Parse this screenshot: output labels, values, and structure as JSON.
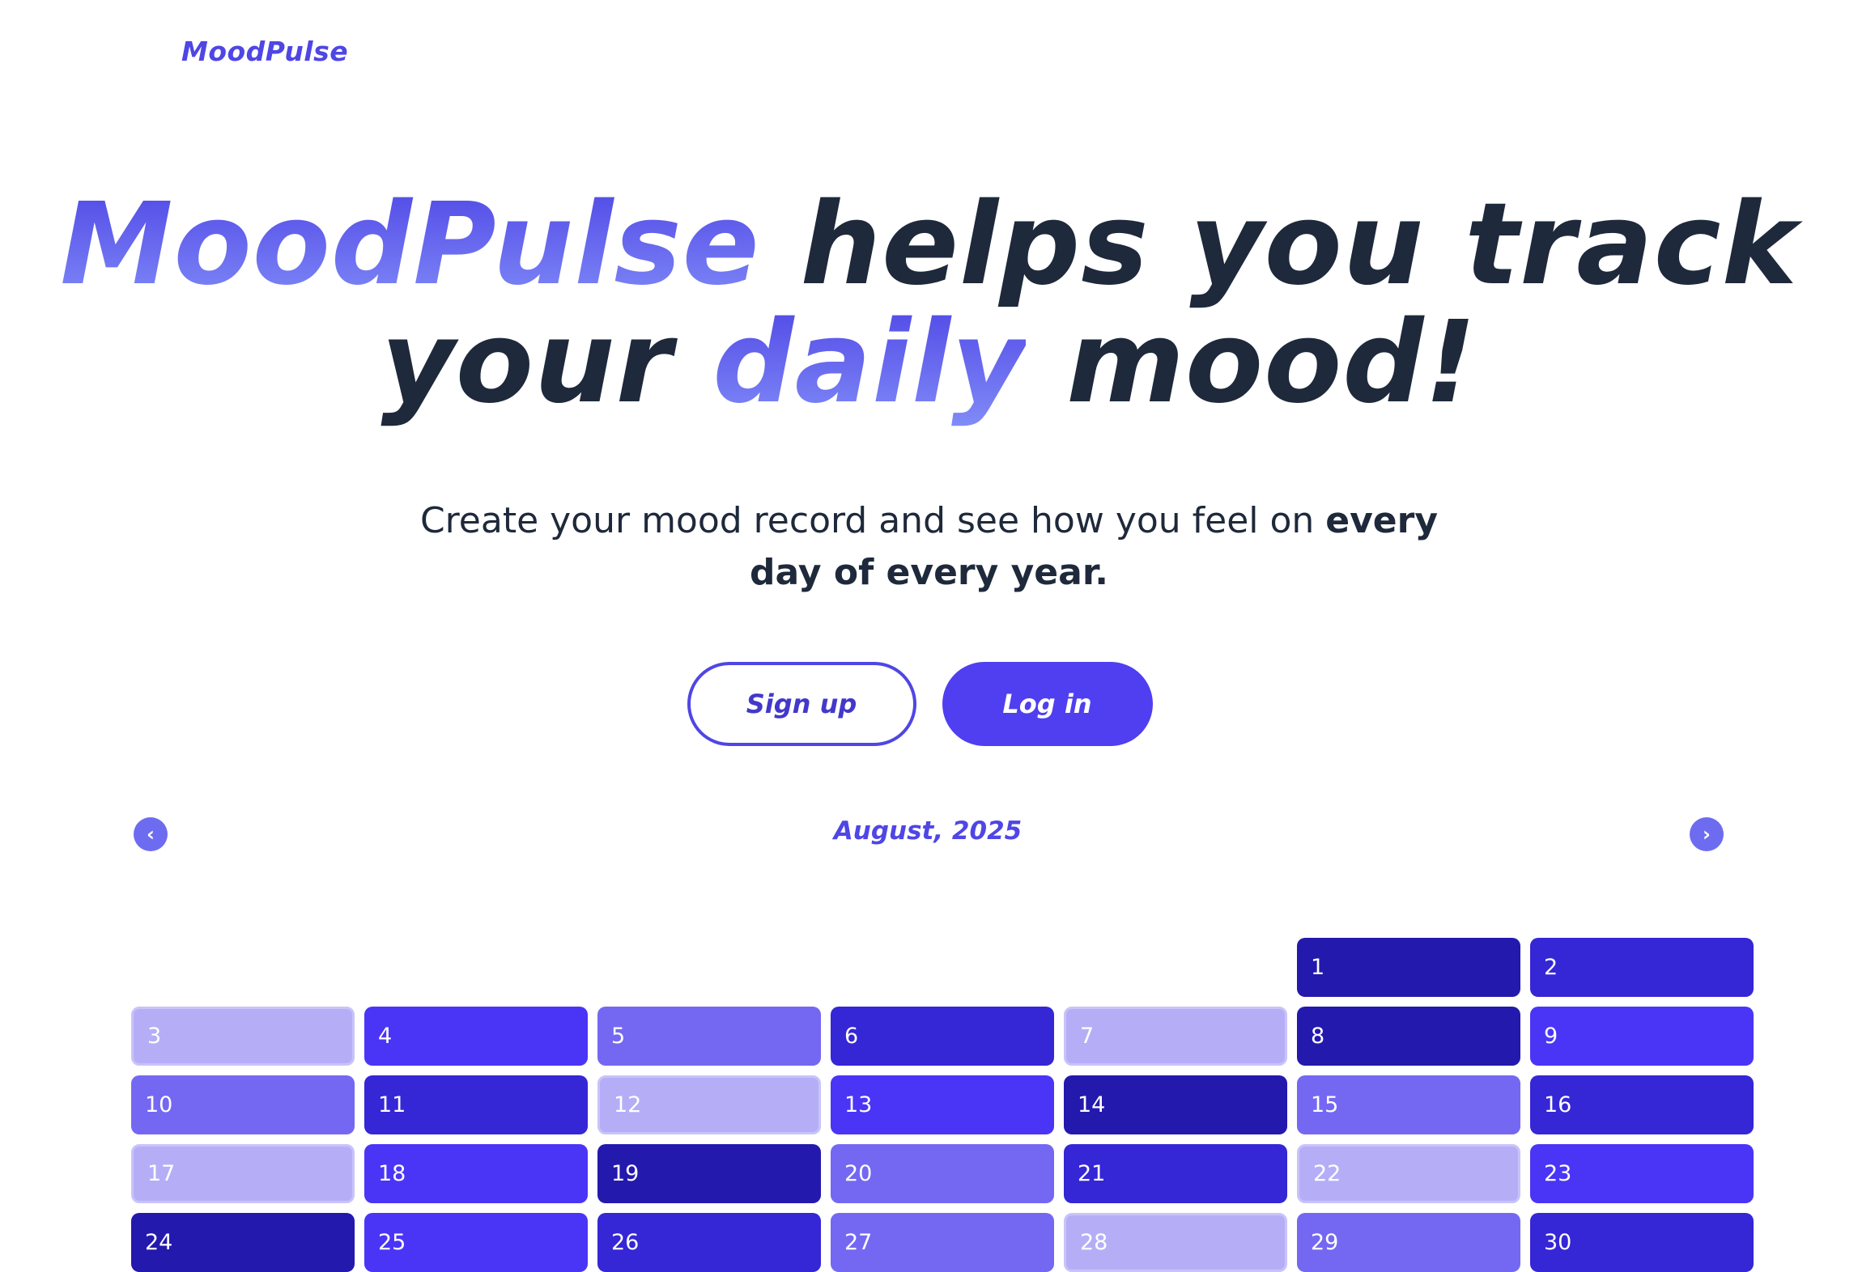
{
  "brand": {
    "logo": "MoodPulse"
  },
  "hero": {
    "headline_brand": "MoodPulse",
    "headline_part1": " helps you track",
    "headline_your": "your ",
    "headline_daily": "daily",
    "headline_end": " mood!",
    "subtitle_plain": "Create your mood record and see how you feel on ",
    "subtitle_bold1": "every",
    "subtitle_bold2": "day of every year."
  },
  "actions": {
    "signup_label": "Sign up",
    "login_label": "Log in"
  },
  "calendar": {
    "month_label": "August, 2025",
    "prev_icon": "chevron-left-icon",
    "next_icon": "chevron-right-icon",
    "mood_colors": {
      "1": "#b5aef7",
      "2": "#7468f2",
      "3": "#4a35f6",
      "4": "#3526d6",
      "5": "#2419ad"
    },
    "leading_empty_cells": 5,
    "days": [
      {
        "day": "1",
        "mood": 5
      },
      {
        "day": "2",
        "mood": 4
      },
      {
        "day": "3",
        "mood": 1
      },
      {
        "day": "4",
        "mood": 3
      },
      {
        "day": "5",
        "mood": 2
      },
      {
        "day": "6",
        "mood": 4
      },
      {
        "day": "7",
        "mood": 1
      },
      {
        "day": "8",
        "mood": 5
      },
      {
        "day": "9",
        "mood": 3
      },
      {
        "day": "10",
        "mood": 2
      },
      {
        "day": "11",
        "mood": 4
      },
      {
        "day": "12",
        "mood": 1
      },
      {
        "day": "13",
        "mood": 3
      },
      {
        "day": "14",
        "mood": 5
      },
      {
        "day": "15",
        "mood": 2
      },
      {
        "day": "16",
        "mood": 4
      },
      {
        "day": "17",
        "mood": 1
      },
      {
        "day": "18",
        "mood": 3
      },
      {
        "day": "19",
        "mood": 5
      },
      {
        "day": "20",
        "mood": 2
      },
      {
        "day": "21",
        "mood": 4
      },
      {
        "day": "22",
        "mood": 1
      },
      {
        "day": "23",
        "mood": 3
      },
      {
        "day": "24",
        "mood": 5
      },
      {
        "day": "25",
        "mood": 3
      },
      {
        "day": "26",
        "mood": 4
      },
      {
        "day": "27",
        "mood": 2
      },
      {
        "day": "28",
        "mood": 1
      },
      {
        "day": "29",
        "mood": 2
      },
      {
        "day": "30",
        "mood": 4
      }
    ]
  }
}
